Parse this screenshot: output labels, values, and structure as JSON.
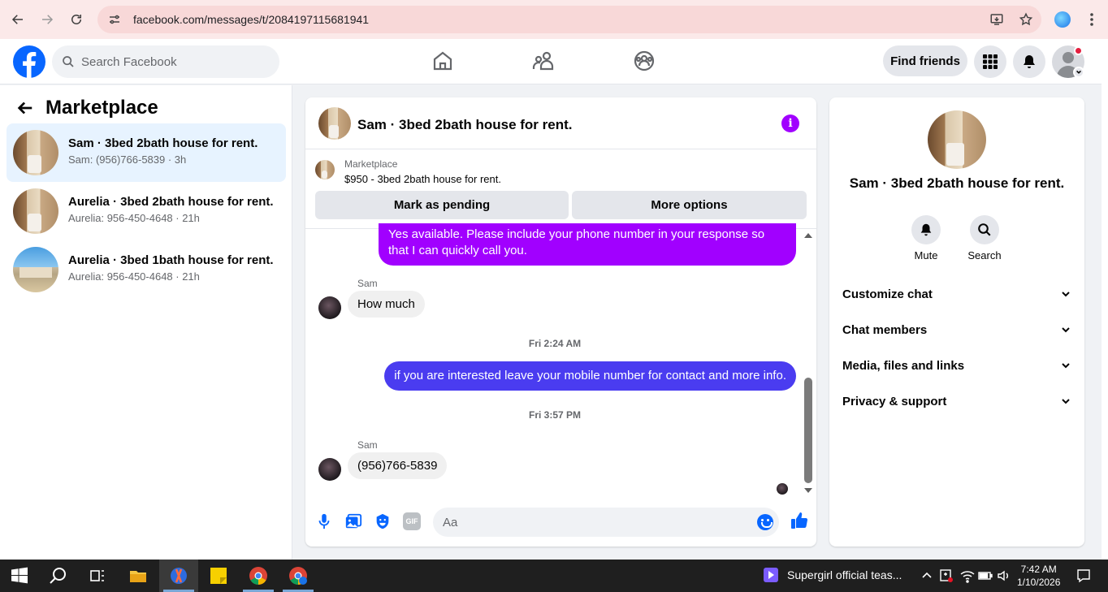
{
  "browser": {
    "url": "facebook.com/messages/t/2084197115681941"
  },
  "header": {
    "search_placeholder": "Search Facebook",
    "find_friends_label": "Find friends"
  },
  "sidebar": {
    "title": "Marketplace",
    "conversations": [
      {
        "title": "Sam · 3bed 2bath house for rent.",
        "subtitle": "Sam: (956)766-5839 · 3h",
        "active": true
      },
      {
        "title": "Aurelia · 3bed 2bath house for rent.",
        "subtitle": "Aurelia: 956-450-4648 · 21h",
        "active": false
      },
      {
        "title": "Aurelia · 3bed 1bath house for rent.",
        "subtitle": "Aurelia: 956-450-4648 · 21h",
        "active": false
      }
    ]
  },
  "chat": {
    "title": "Sam · 3bed 2bath house for rent.",
    "marketplace_label": "Marketplace",
    "listing": "$950 - 3bed 2bath house for rent.",
    "mark_pending_label": "Mark as pending",
    "more_options_label": "More options",
    "messages": {
      "m1": "Yes available. Please include your phone number in your response so that I can quickly call you.",
      "sender1": "Sam",
      "m2": "How much",
      "time1": "Fri 2:24 AM",
      "m3": "if you are interested leave your mobile number for contact and more info.",
      "time2": "Fri 3:57 PM",
      "sender2": "Sam",
      "m4": "(956)766-5839"
    },
    "composer_placeholder": "Aa",
    "colors": {
      "purple": "#a100ff",
      "blue_purple": "#4a3cf0",
      "accent": "#0866ff"
    }
  },
  "details": {
    "title": "Sam · 3bed 2bath house for rent.",
    "mute_label": "Mute",
    "search_label": "Search",
    "rows": [
      "Customize chat",
      "Chat members",
      "Media, files and links",
      "Privacy & support"
    ]
  },
  "taskbar": {
    "media_title": "Supergirl official teas...",
    "time": "7:42 AM",
    "date": "1/10/2026"
  }
}
